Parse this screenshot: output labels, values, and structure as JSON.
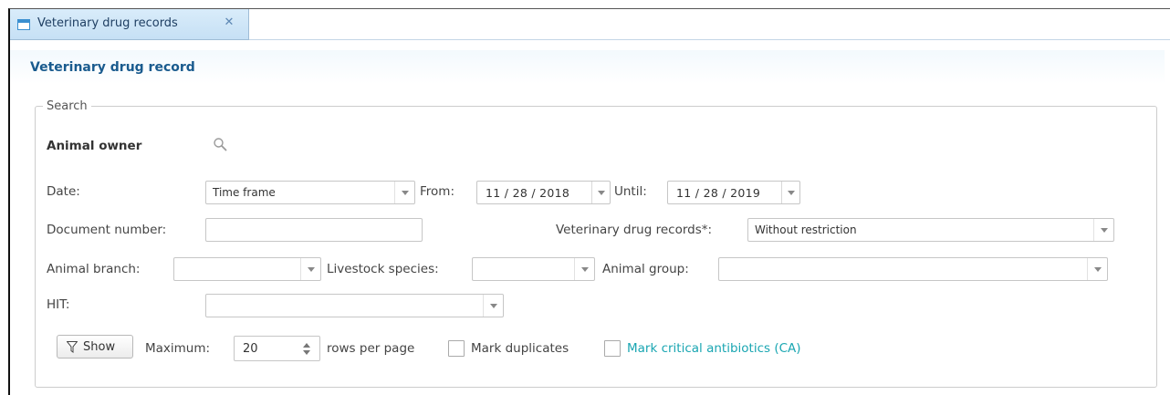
{
  "tab": {
    "label": "Veterinary drug records",
    "close_icon": "close-icon"
  },
  "panel": {
    "title": "Veterinary drug record"
  },
  "search": {
    "legend": "Search",
    "animal_owner_label": "Animal owner",
    "date_label": "Date:",
    "date_mode_value": "Time frame",
    "from_label": "From:",
    "from_value": "11 / 28 / 2018",
    "until_label": "Until:",
    "until_value": "11 / 28 / 2019",
    "document_number_label": "Document number:",
    "document_number_value": "",
    "vet_records_label": "Veterinary drug records*:",
    "vet_records_value": "Without restriction",
    "animal_branch_label": "Animal branch:",
    "animal_branch_value": "",
    "livestock_species_label": "Livestock species:",
    "livestock_species_value": "",
    "animal_group_label": "Animal group:",
    "animal_group_value": "",
    "hit_label": "HIT:",
    "hit_value": ""
  },
  "actions": {
    "show_label": "Show",
    "maximum_label": "Maximum:",
    "maximum_value": "20",
    "rows_per_page_label": "rows per page",
    "mark_duplicates_label": "Mark duplicates",
    "mark_duplicates_checked": false,
    "mark_ca_label": "Mark critical antibiotics (CA)",
    "mark_ca_checked": false
  },
  "colors": {
    "accent": "#1a5b8e",
    "tab_bg": "#c6e0f5",
    "ca_text": "#1aa6b2"
  }
}
